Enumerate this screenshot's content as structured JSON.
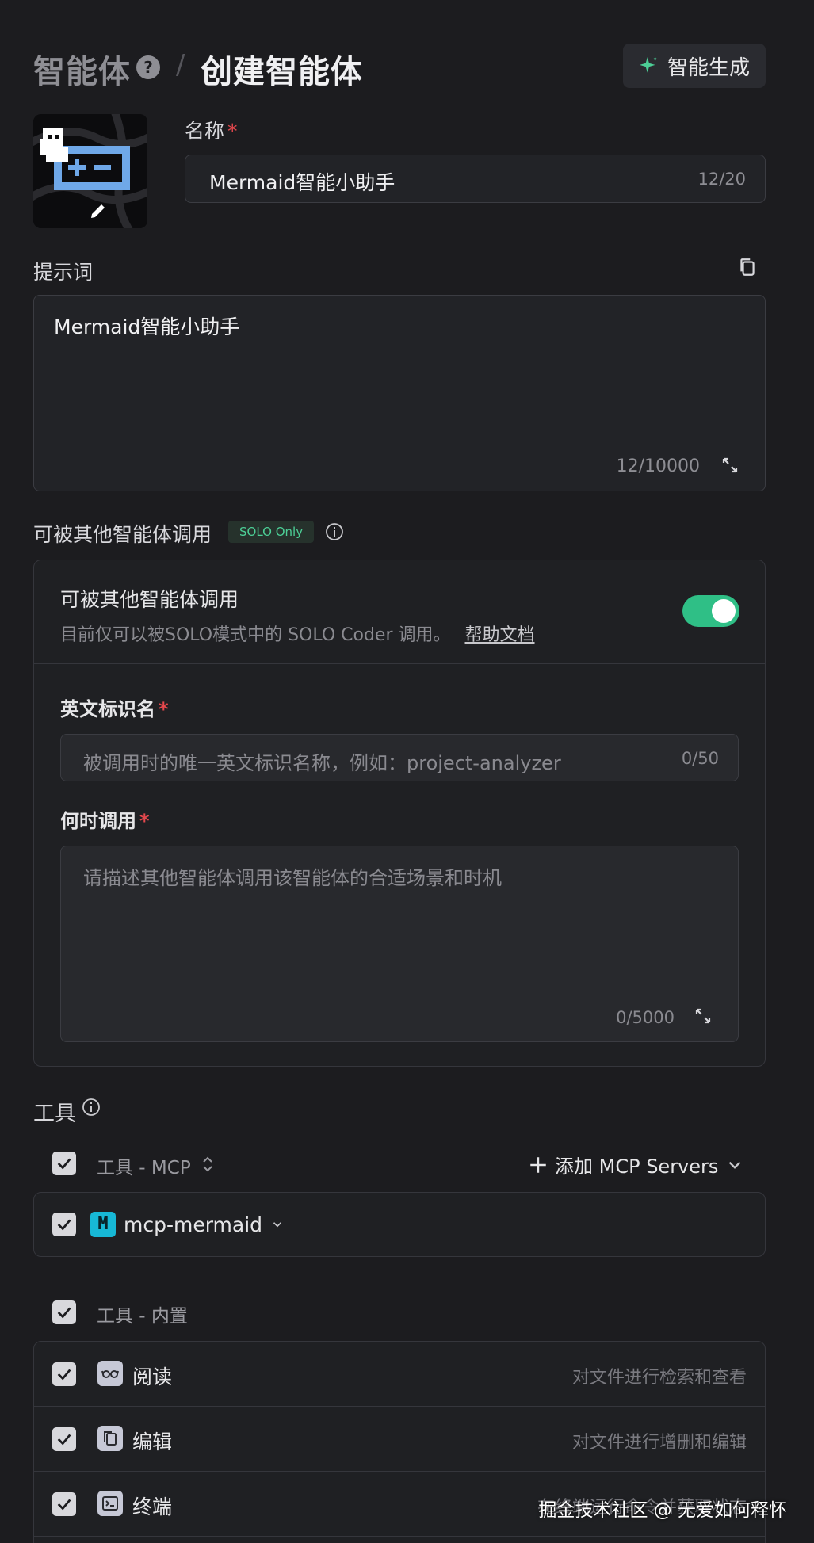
{
  "header": {
    "breadcrumb_root": "智能体",
    "breadcrumb_help": "?",
    "breadcrumb_separator": "/",
    "page_title": "创建智能体",
    "generate_button_label": "智能生成"
  },
  "name_field": {
    "label": "名称",
    "required_mark": "*",
    "value": "Mermaid智能小助手",
    "count": "12/20"
  },
  "prompt": {
    "label": "提示词",
    "value": "Mermaid智能小助手",
    "count": "12/10000"
  },
  "callable": {
    "section_label": "可被其他智能体调用",
    "badge": "SOLO Only",
    "card_title": "可被其他智能体调用",
    "description": "目前仅可以被SOLO模式中的 SOLO Coder 调用。",
    "help_link": "帮助文档",
    "toggle_on": true,
    "english_id": {
      "label": "英文标识名",
      "required_mark": "*",
      "placeholder": "被调用时的唯一英文标识名称，例如：project-analyzer",
      "count": "0/50"
    },
    "when_to_call": {
      "label": "何时调用",
      "required_mark": "*",
      "placeholder": "请描述其他智能体调用该智能体的合适场景和时机",
      "count": "0/5000"
    }
  },
  "tools": {
    "section_label": "工具",
    "mcp_header": "工具 - MCP",
    "add_mcp_label": "添加 MCP Servers",
    "mcp_items": [
      {
        "badge": "M",
        "name": "mcp-mermaid",
        "checked": true
      }
    ],
    "builtin_header": "工具 - 内置",
    "builtin_items": [
      {
        "icon": "glasses-icon",
        "name": "阅读",
        "desc": "对文件进行检索和查看",
        "checked": true
      },
      {
        "icon": "files-icon",
        "name": "编辑",
        "desc": "对文件进行增删和编辑",
        "checked": true
      },
      {
        "icon": "terminal-icon",
        "name": "终端",
        "desc": "在终端运行命令并获取状态",
        "checked": true
      }
    ]
  },
  "watermark": "掘金技术社区 @ 无爱如何释怀",
  "colors": {
    "background": "#1c1c1f",
    "accent_green": "#2fbf86",
    "required_red": "#e5484d",
    "mcp_badge": "#17b8d6"
  }
}
